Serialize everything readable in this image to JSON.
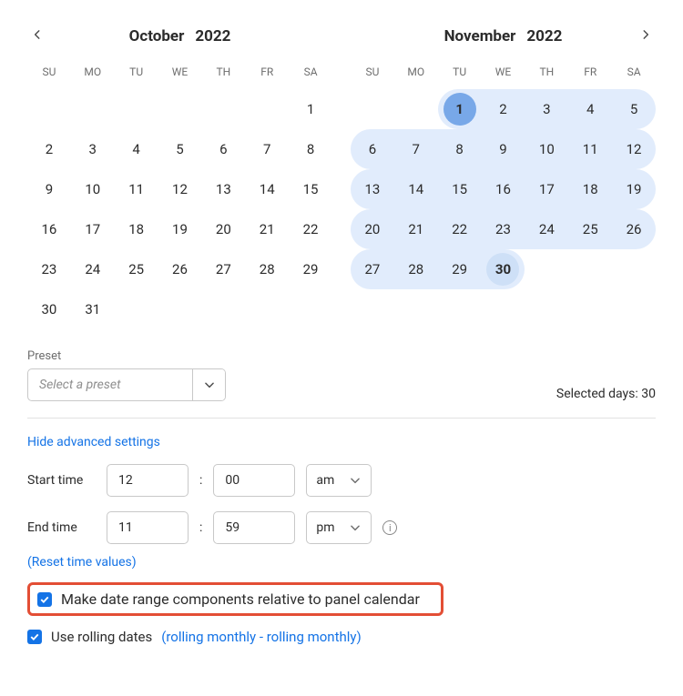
{
  "dow": [
    "SU",
    "MO",
    "TU",
    "WE",
    "TH",
    "FR",
    "SA"
  ],
  "months": {
    "left": {
      "label": "October",
      "year": "2022",
      "offset": 6,
      "days": 31
    },
    "right": {
      "label": "November",
      "year": "2022",
      "offset": 2,
      "days": 30
    }
  },
  "selection": {
    "start": "2022-11-01",
    "end": "2022-11-30",
    "days_label": "Selected days: 30"
  },
  "preset": {
    "label": "Preset",
    "placeholder": "Select a preset"
  },
  "advanced": {
    "toggle": "Hide advanced settings",
    "start_label": "Start time",
    "end_label": "End time",
    "start_hour": "12",
    "start_min": "00",
    "start_ampm": "am",
    "end_hour": "11",
    "end_min": "59",
    "end_ampm": "pm",
    "reset": "(Reset time values)"
  },
  "options": {
    "relative": "Make date range components relative to panel calendar",
    "rolling_label": "Use rolling dates",
    "rolling_desc": "(rolling monthly - rolling monthly)"
  }
}
